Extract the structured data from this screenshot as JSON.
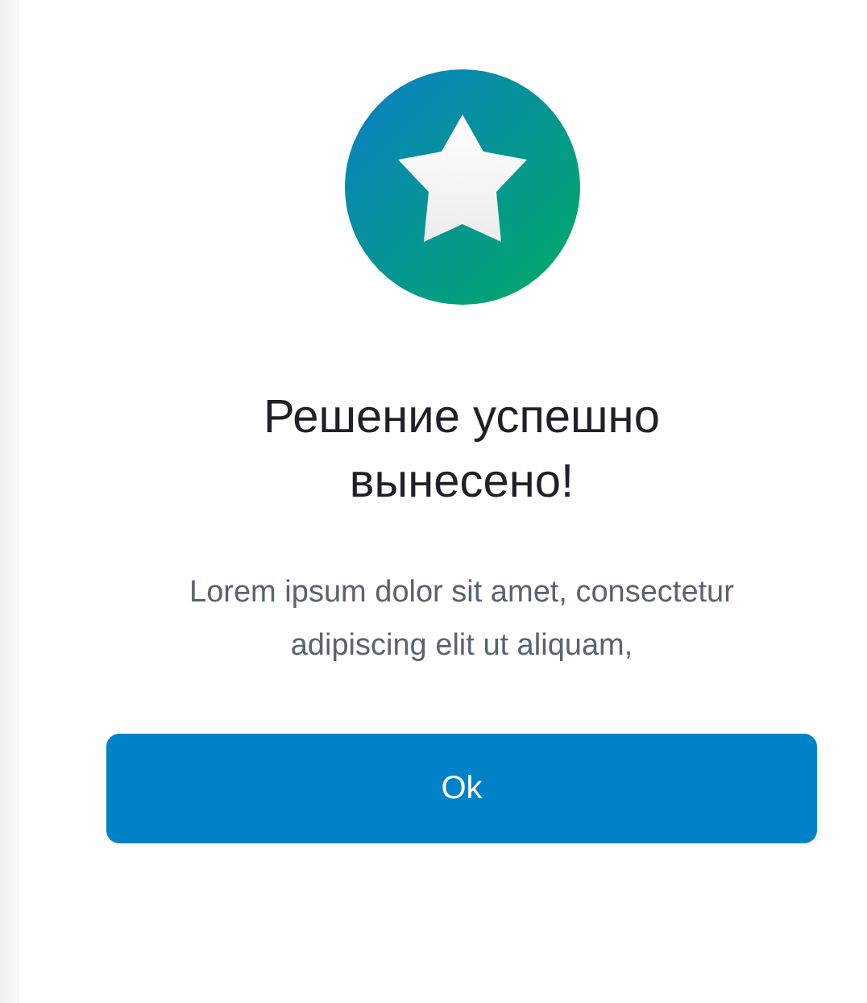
{
  "dialog": {
    "title": "Решение успешно вынесено!",
    "message": "Lorem ipsum dolor sit amet, consectetur adipiscing elit ut aliquam,",
    "button": "Ok"
  }
}
